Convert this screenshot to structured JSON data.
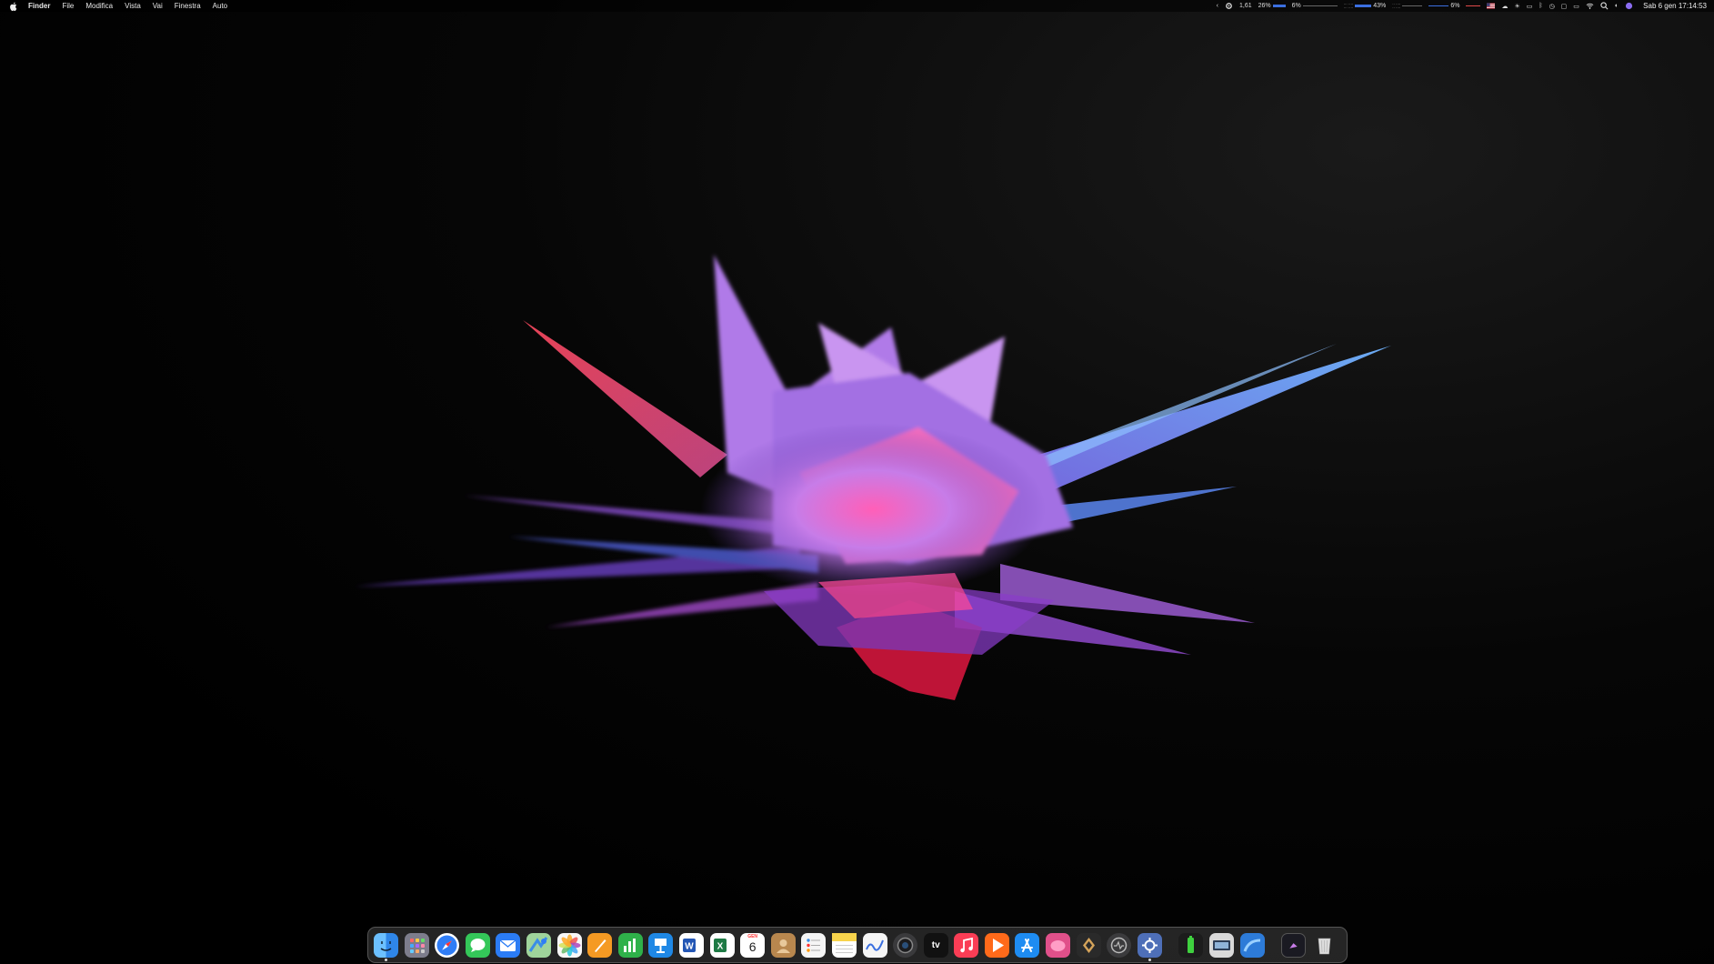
{
  "menubar": {
    "app_name": "Finder",
    "menus": [
      "File",
      "Modifica",
      "Vista",
      "Vai",
      "Finestra",
      "Auto"
    ],
    "status": {
      "cpu_load": "1,61",
      "cpu_percent": "26%",
      "gpu_percent": "6%",
      "memory_percent": "43%",
      "disk_percent": "6%"
    },
    "clock": "Sab 6 gen 17:14:53"
  },
  "dock": {
    "apps": [
      {
        "name": "Finder",
        "color": "#3a8ee6"
      },
      {
        "name": "Launchpad",
        "color": "#8a8a9a"
      },
      {
        "name": "Safari",
        "color": "#2f7df6"
      },
      {
        "name": "Messaggi",
        "color": "#34c759"
      },
      {
        "name": "Mail",
        "color": "#2b7cf5"
      },
      {
        "name": "Mappe",
        "color": "#5cb85c"
      },
      {
        "name": "Foto",
        "color": "#f2f2f2"
      },
      {
        "name": "Pages",
        "color": "#f59a23"
      },
      {
        "name": "Numbers",
        "color": "#2fb14a"
      },
      {
        "name": "Keynote",
        "color": "#1f88e5"
      },
      {
        "name": "Word",
        "color": "#2457b5"
      },
      {
        "name": "Excel",
        "color": "#1e7a45"
      },
      {
        "name": "Calendario",
        "color": "#ffffff",
        "month": "GEN",
        "day": "6"
      },
      {
        "name": "Contatti",
        "color": "#b8874e"
      },
      {
        "name": "Promemoria",
        "color": "#f5f5f5"
      },
      {
        "name": "Note",
        "color": "#f8d44c"
      },
      {
        "name": "Freeform",
        "color": "#f5f5f5"
      },
      {
        "name": "Screenshot",
        "color": "#3a3a3c"
      },
      {
        "name": "Apple TV",
        "color": "#111111",
        "label": "tv"
      },
      {
        "name": "Musica",
        "color": "#fa3d55"
      },
      {
        "name": "Infuse",
        "color": "#ff6a1a"
      },
      {
        "name": "App Store",
        "color": "#1e8cf2"
      },
      {
        "name": "Pixelmator",
        "color": "#e0508a"
      },
      {
        "name": "Affinity",
        "color": "#2a2a2a"
      },
      {
        "name": "Monitor",
        "color": "#3b3b3d"
      },
      {
        "name": "Impostazioni",
        "color": "#4e6fb8"
      },
      {
        "name": "Battery",
        "color": "#1c1c1c"
      },
      {
        "name": "Preview",
        "color": "#d9d9d9"
      },
      {
        "name": "Network",
        "color": "#2d7bd8"
      },
      {
        "name": "Recent",
        "color": "#1a1a22"
      },
      {
        "name": "Cestino",
        "color": "#c9c9c9"
      }
    ]
  }
}
